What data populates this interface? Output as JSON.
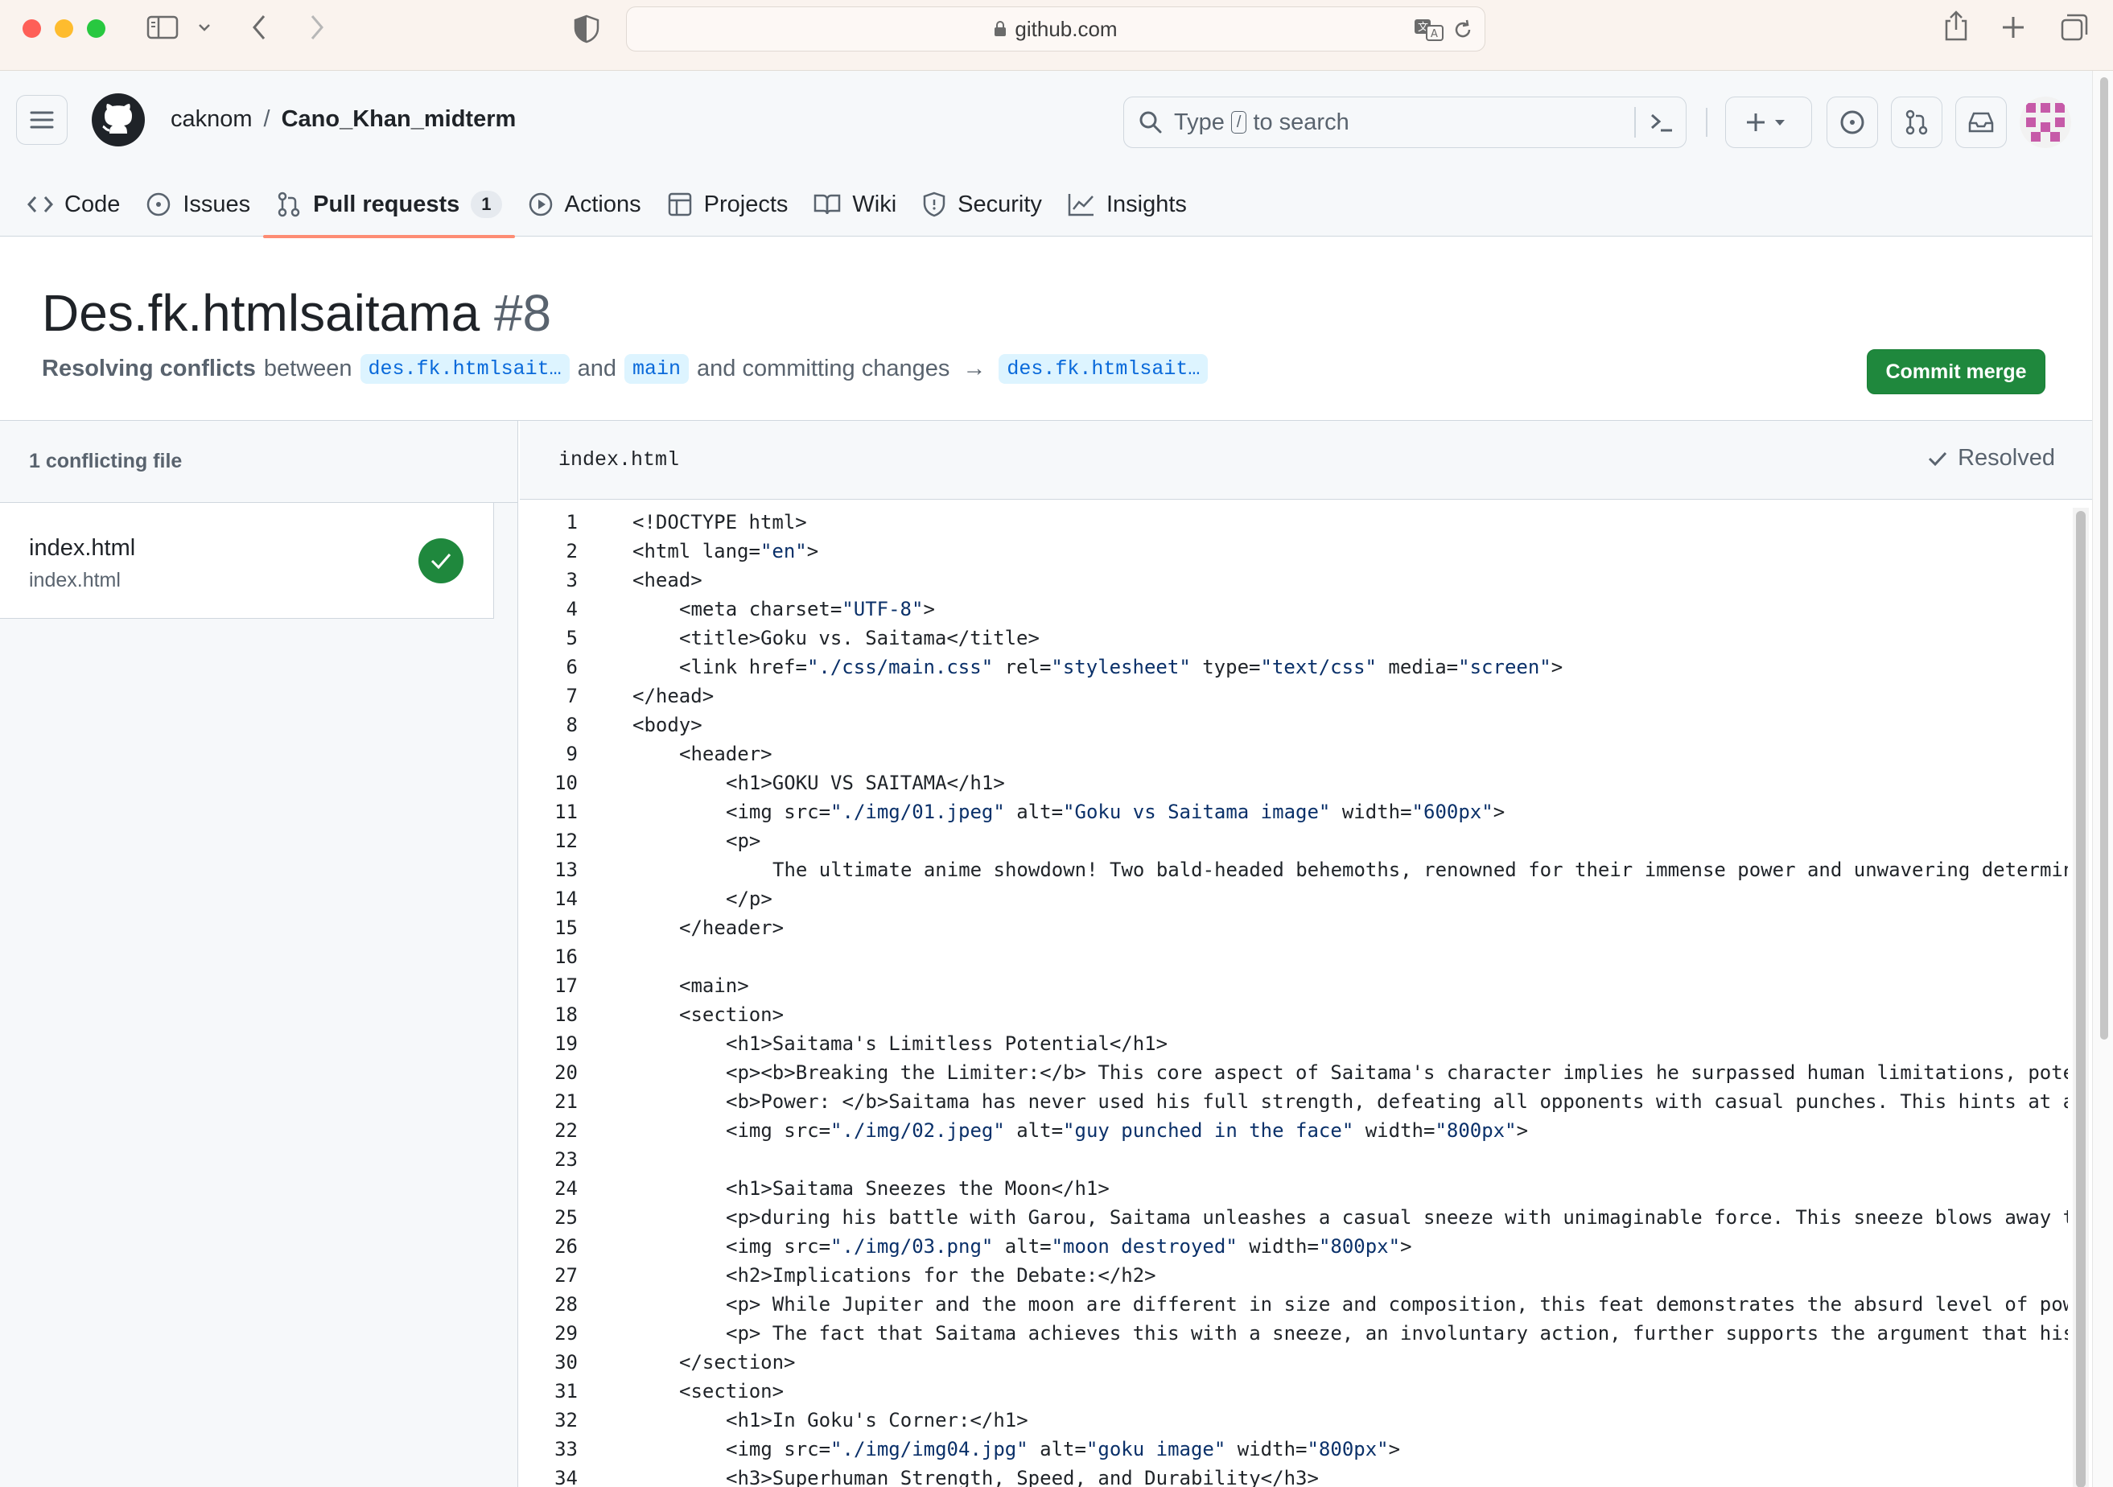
{
  "browser": {
    "url": "github.com"
  },
  "header": {
    "owner": "caknom",
    "separator": "/",
    "repo": "Cano_Khan_midterm",
    "search": {
      "placeholder_before": "Type",
      "slash_key": "/",
      "placeholder_after": "to search"
    }
  },
  "nav": {
    "tabs": [
      {
        "label": "Code",
        "icon": "code-icon"
      },
      {
        "label": "Issues",
        "icon": "issue-opened-icon"
      },
      {
        "label": "Pull requests",
        "icon": "git-pull-request-icon",
        "count": "1",
        "active": true
      },
      {
        "label": "Actions",
        "icon": "play-icon"
      },
      {
        "label": "Projects",
        "icon": "table-icon"
      },
      {
        "label": "Wiki",
        "icon": "book-icon"
      },
      {
        "label": "Security",
        "icon": "shield-icon"
      },
      {
        "label": "Insights",
        "icon": "graph-icon"
      }
    ]
  },
  "pr": {
    "title": "Des.fk.htmlsaitama",
    "number": "#8",
    "subtitle": {
      "bold": "Resolving conflicts",
      "between": "between",
      "head_branch": "des.fk.htmlsait…",
      "and": "and",
      "base_branch": "main",
      "committing": "and committing changes",
      "arrow": "→",
      "target_branch": "des.fk.htmlsait…"
    },
    "commit_button": "Commit merge"
  },
  "sidebar": {
    "heading": "1 conflicting file",
    "files": [
      {
        "name": "index.html",
        "path": "index.html",
        "status": "resolved"
      }
    ]
  },
  "editor": {
    "filename": "index.html",
    "status_label": "Resolved",
    "lines": [
      {
        "n": "1",
        "indent": 0,
        "parts": [
          [
            "t",
            "<!DOCTYPE html>"
          ]
        ]
      },
      {
        "n": "2",
        "indent": 0,
        "parts": [
          [
            "t",
            "<html lang="
          ],
          [
            "s",
            "\"en\""
          ],
          [
            "t",
            ">"
          ]
        ]
      },
      {
        "n": "3",
        "indent": 0,
        "parts": [
          [
            "t",
            "<head>"
          ]
        ]
      },
      {
        "n": "4",
        "indent": 1,
        "parts": [
          [
            "t",
            "<meta charset="
          ],
          [
            "s",
            "\"UTF-8\""
          ],
          [
            "t",
            ">"
          ]
        ]
      },
      {
        "n": "5",
        "indent": 1,
        "parts": [
          [
            "t",
            "<title>Goku vs. Saitama</title>"
          ]
        ]
      },
      {
        "n": "6",
        "indent": 1,
        "parts": [
          [
            "t",
            "<link href="
          ],
          [
            "s",
            "\"./css/main.css\""
          ],
          [
            "t",
            " rel="
          ],
          [
            "s",
            "\"stylesheet\""
          ],
          [
            "t",
            " type="
          ],
          [
            "s",
            "\"text/css\""
          ],
          [
            "t",
            " media="
          ],
          [
            "s",
            "\"screen\""
          ],
          [
            "t",
            ">"
          ]
        ]
      },
      {
        "n": "7",
        "indent": 0,
        "parts": [
          [
            "t",
            "</head>"
          ]
        ]
      },
      {
        "n": "8",
        "indent": 0,
        "parts": [
          [
            "t",
            "<body>"
          ]
        ]
      },
      {
        "n": "9",
        "indent": 1,
        "parts": [
          [
            "t",
            "<header>"
          ]
        ]
      },
      {
        "n": "10",
        "indent": 2,
        "parts": [
          [
            "t",
            "<h1>GOKU VS SAITAMA</h1>"
          ]
        ]
      },
      {
        "n": "11",
        "indent": 2,
        "parts": [
          [
            "t",
            "<img src="
          ],
          [
            "s",
            "\"./img/01.jpeg\""
          ],
          [
            "t",
            " alt="
          ],
          [
            "s",
            "\"Goku vs Saitama image\""
          ],
          [
            "t",
            " width="
          ],
          [
            "s",
            "\"600px\""
          ],
          [
            "t",
            ">"
          ]
        ]
      },
      {
        "n": "12",
        "indent": 2,
        "parts": [
          [
            "t",
            "<p>"
          ]
        ]
      },
      {
        "n": "13",
        "indent": 3,
        "parts": [
          [
            "t",
            "The ultimate anime showdown! Two bald-headed behemoths, renowned for their immense power and unwavering determin"
          ]
        ]
      },
      {
        "n": "14",
        "indent": 2,
        "parts": [
          [
            "t",
            "</p>"
          ]
        ]
      },
      {
        "n": "15",
        "indent": 1,
        "parts": [
          [
            "t",
            "</header>"
          ]
        ]
      },
      {
        "n": "16",
        "indent": 0,
        "parts": [
          [
            "t",
            ""
          ]
        ]
      },
      {
        "n": "17",
        "indent": 1,
        "parts": [
          [
            "t",
            "<main>"
          ]
        ]
      },
      {
        "n": "18",
        "indent": 1,
        "parts": [
          [
            "t",
            "<section>"
          ]
        ]
      },
      {
        "n": "19",
        "indent": 2,
        "parts": [
          [
            "t",
            "<h1>Saitama's Limitless Potential</h1>"
          ]
        ]
      },
      {
        "n": "20",
        "indent": 2,
        "parts": [
          [
            "t",
            "<p><b>Breaking the Limiter:</b> This core aspect of Saitama's character implies he surpassed human limitations, pote"
          ]
        ]
      },
      {
        "n": "21",
        "indent": 2,
        "parts": [
          [
            "t",
            "<b>Power: </b>Saitama has never used his full strength, defeating all opponents with casual punches. This hints at a"
          ]
        ]
      },
      {
        "n": "22",
        "indent": 2,
        "parts": [
          [
            "t",
            "<img src="
          ],
          [
            "s",
            "\"./img/02.jpeg\""
          ],
          [
            "t",
            " alt="
          ],
          [
            "s",
            "\"guy punched in the face\""
          ],
          [
            "t",
            " width="
          ],
          [
            "s",
            "\"800px\""
          ],
          [
            "t",
            ">"
          ]
        ]
      },
      {
        "n": "23",
        "indent": 0,
        "parts": [
          [
            "t",
            ""
          ]
        ]
      },
      {
        "n": "24",
        "indent": 2,
        "parts": [
          [
            "t",
            "<h1>Saitama Sneezes the Moon</h1>"
          ]
        ]
      },
      {
        "n": "25",
        "indent": 2,
        "parts": [
          [
            "t",
            "<p>during his battle with Garou, Saitama unleashes a casual sneeze with unimaginable force. This sneeze blows away t"
          ]
        ]
      },
      {
        "n": "26",
        "indent": 2,
        "parts": [
          [
            "t",
            "<img src="
          ],
          [
            "s",
            "\"./img/03.png\""
          ],
          [
            "t",
            " alt="
          ],
          [
            "s",
            "\"moon destroyed\""
          ],
          [
            "t",
            " width="
          ],
          [
            "s",
            "\"800px\""
          ],
          [
            "t",
            ">"
          ]
        ]
      },
      {
        "n": "27",
        "indent": 2,
        "parts": [
          [
            "t",
            "<h2>Implications for the Debate:</h2>"
          ]
        ]
      },
      {
        "n": "28",
        "indent": 2,
        "parts": [
          [
            "t",
            "<p> While Jupiter and the moon are different in size and composition, this feat demonstrates the absurd level of pow"
          ]
        ]
      },
      {
        "n": "29",
        "indent": 2,
        "parts": [
          [
            "t",
            "<p> The fact that Saitama achieves this with a sneeze, an involuntary action, further supports the argument that his"
          ]
        ]
      },
      {
        "n": "30",
        "indent": 1,
        "parts": [
          [
            "t",
            "</section>"
          ]
        ]
      },
      {
        "n": "31",
        "indent": 1,
        "parts": [
          [
            "t",
            "<section>"
          ]
        ]
      },
      {
        "n": "32",
        "indent": 2,
        "parts": [
          [
            "t",
            "<h1>In Goku's Corner:</h1>"
          ]
        ]
      },
      {
        "n": "33",
        "indent": 2,
        "parts": [
          [
            "t",
            "<img src="
          ],
          [
            "s",
            "\"./img/img04.jpg\""
          ],
          [
            "t",
            " alt="
          ],
          [
            "s",
            "\"goku image\""
          ],
          [
            "t",
            " width="
          ],
          [
            "s",
            "\"800px\""
          ],
          [
            "t",
            ">"
          ]
        ]
      },
      {
        "n": "34",
        "indent": 2,
        "parts": [
          [
            "t",
            "<h3>Superhuman Strength, Speed, and Durability</h3>"
          ]
        ]
      }
    ]
  },
  "colors": {
    "primary_button": "#1f883d",
    "active_tab_underline": "#fd8c73",
    "string_token": "#0a3069",
    "branch_bg": "#ddf4ff",
    "branch_text": "#0969da"
  }
}
